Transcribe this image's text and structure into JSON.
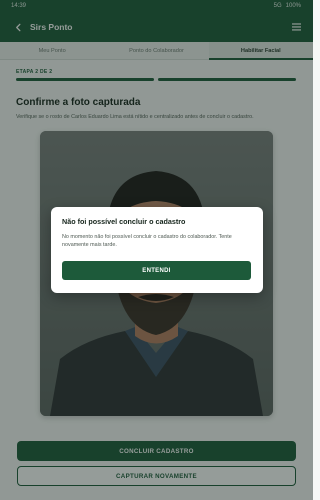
{
  "status_bar": {
    "time": "14:39",
    "network": "5G",
    "battery": "100%"
  },
  "app_bar": {
    "title": "Sirs Ponto",
    "back_icon": "arrow-left-icon",
    "menu_icon": "hamburger-menu-icon"
  },
  "tabs": [
    {
      "label": "Meu Ponto",
      "active": false
    },
    {
      "label": "Ponto do Colaborador",
      "active": false
    },
    {
      "label": "Habilitar Facial",
      "active": true
    }
  ],
  "step": {
    "label": "ETAPA 2 DE 2",
    "current": 2,
    "total": 2
  },
  "content": {
    "heading": "Confirme a foto capturada",
    "description": "Verifique se o rosto de Carlos Eduardo Lima está nítido e centralizado antes de concluir o cadastro."
  },
  "actions": {
    "confirm": "CONCLUIR CADASTRO",
    "retake": "CAPTURAR NOVAMENTE"
  },
  "dialog": {
    "title": "Não foi possível concluir o cadastro",
    "message": "No momento não foi possível concluir o cadastro do colaborador. Tente novamente mais tarde.",
    "button": "ENTENDI"
  },
  "colors": {
    "primary": "#1d5a3a",
    "background": "#f7f8f7",
    "overlay": "rgba(20,35,28,0.45)"
  }
}
